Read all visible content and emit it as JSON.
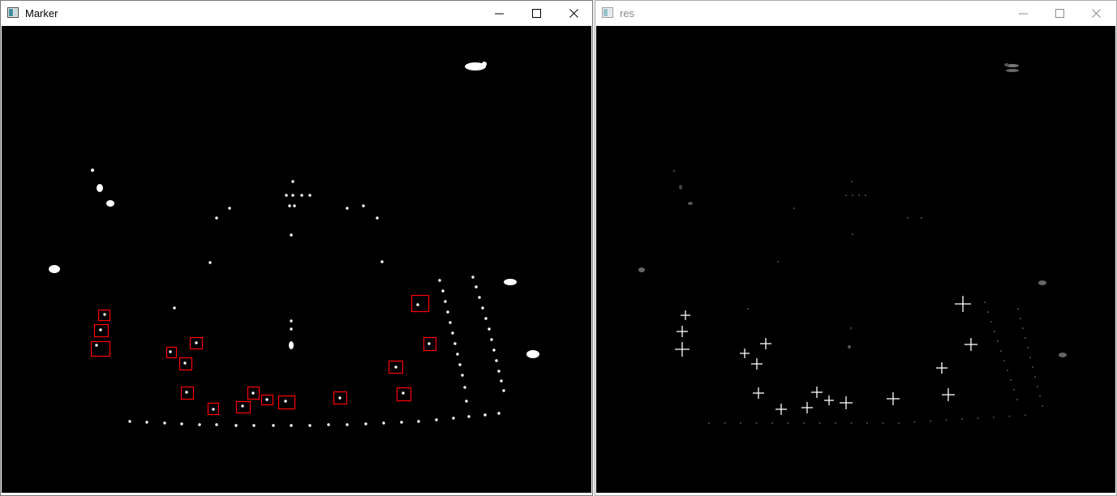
{
  "windows": {
    "marker": {
      "title": "Marker"
    },
    "res": {
      "title": "res"
    }
  },
  "controls": [
    "minimize-icon",
    "maximize-icon",
    "close-icon"
  ],
  "colors": {
    "title_active": "#000000",
    "title_inactive": "#8a8a8a",
    "canvas_background": "#000000",
    "marker_box": "#ff0000",
    "blob": "#ffffff",
    "cross": "#ffffff"
  }
}
